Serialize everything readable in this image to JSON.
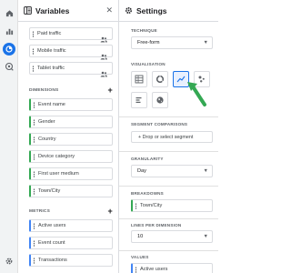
{
  "rail": {
    "icons": [
      "home-icon",
      "reports-icon",
      "explore-icon",
      "advertising-icon",
      "admin-gear-icon"
    ]
  },
  "variables": {
    "title": "Variables",
    "segments": [
      {
        "label": "Paid traffic"
      },
      {
        "label": "Mobile traffic"
      },
      {
        "label": "Tablet traffic"
      }
    ],
    "dimensions_heading": "DIMENSIONS",
    "dimensions": [
      "Event name",
      "Gender",
      "Country",
      "Device category",
      "First user medium",
      "Town/City"
    ],
    "metrics_heading": "METRICS",
    "metrics": [
      "Active users",
      "Event count",
      "Transactions"
    ]
  },
  "settings": {
    "title": "Settings",
    "technique_label": "TECHNIQUE",
    "technique_value": "Free-form",
    "visualisation_label": "VISUALISATION",
    "visualisations": [
      "table",
      "donut-chart",
      "line-chart",
      "scatter-plot",
      "bar-chart",
      "geo-map"
    ],
    "selected_visualisation": "line-chart",
    "segment_comparisons_label": "SEGMENT COMPARISONS",
    "segment_drop": "+ Drop or select segment",
    "granularity_label": "GRANULARITY",
    "granularity_value": "Day",
    "breakdowns_label": "BREAKDOWNS",
    "breakdown_value": "Town/City",
    "lines_label": "LINES PER DIMENSION",
    "lines_value": "10",
    "values_label": "VALUES",
    "values_value": "Active users"
  },
  "colors": {
    "accent": "#1a73e8",
    "dimension": "#34a853",
    "metric": "#4285f4",
    "annotation_arrow": "#34a853"
  }
}
